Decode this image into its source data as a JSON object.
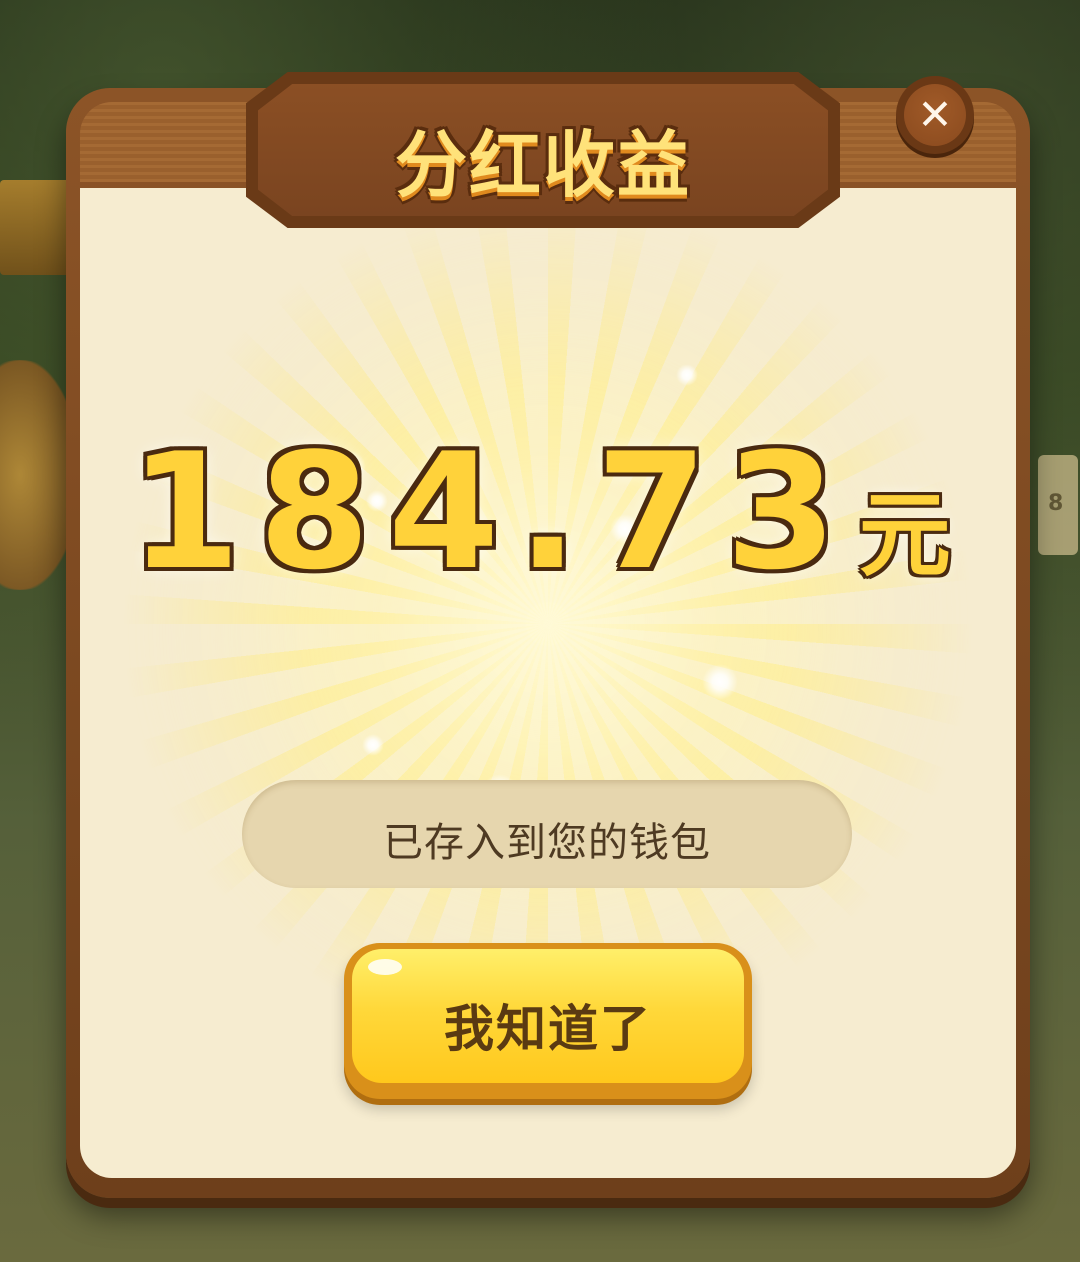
{
  "dialog": {
    "title": "分红收益",
    "close_icon": "close-icon",
    "amount": {
      "value": "184.73",
      "unit": "元"
    },
    "status_message": "已存入到您的钱包",
    "confirm_label": "我知道了"
  },
  "background": {
    "side_badge_text": "8"
  },
  "colors": {
    "frame_brown": "#8c5427",
    "panel_cream": "#f6ecd0",
    "gold_text": "#ffd23a",
    "button_yellow": "#ffd83a",
    "pill_beige": "#e6d6ae"
  }
}
